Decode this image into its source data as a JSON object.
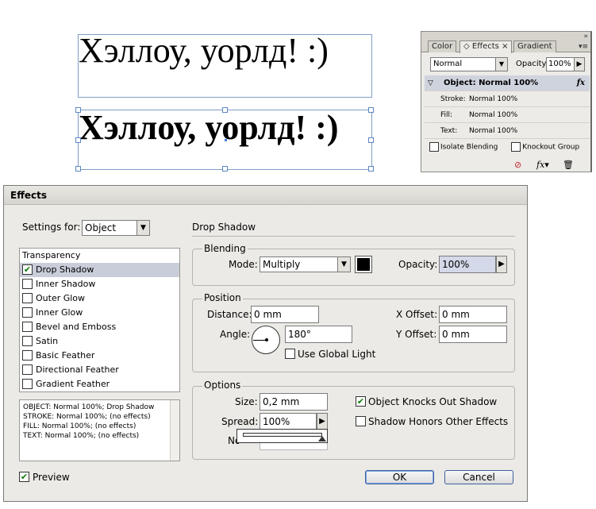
{
  "canvas": {
    "frame1_text": "Хэллоу, уорлд!  :)",
    "frame2_text": "Хэллоу, уорлд!  :)"
  },
  "effects_panel": {
    "tabs": [
      "Color",
      "Effects",
      "Gradient"
    ],
    "tab_close": "×",
    "blend_mode": "Normal",
    "opacity_label": "Opacity:",
    "opacity_value": "100%",
    "rows": [
      {
        "label": "Object:",
        "value": "Normal 100%"
      },
      {
        "label": "Stroke:",
        "value": "Normal 100%"
      },
      {
        "label": "Fill:",
        "value": "Normal 100%"
      },
      {
        "label": "Text:",
        "value": "Normal 100%"
      }
    ],
    "isolate_blending": "Isolate Blending",
    "knockout_group": "Knockout Group",
    "fx_label": "fx"
  },
  "dialog": {
    "title": "Effects",
    "settings_for_label": "Settings for:",
    "settings_for_value": "Object",
    "section_title": "Drop Shadow",
    "effects_header": "Transparency",
    "effects": [
      {
        "label": "Drop Shadow",
        "checked": true
      },
      {
        "label": "Inner Shadow",
        "checked": false
      },
      {
        "label": "Outer Glow",
        "checked": false
      },
      {
        "label": "Inner Glow",
        "checked": false
      },
      {
        "label": "Bevel and Emboss",
        "checked": false
      },
      {
        "label": "Satin",
        "checked": false
      },
      {
        "label": "Basic Feather",
        "checked": false
      },
      {
        "label": "Directional Feather",
        "checked": false
      },
      {
        "label": "Gradient Feather",
        "checked": false
      }
    ],
    "summary_lines": [
      "OBJECT: Normal 100%; Drop Shadow",
      "STROKE: Normal 100%; (no effects)",
      "FILL: Normal 100%; (no effects)",
      "TEXT: Normal 100%; (no effects)"
    ],
    "blending": {
      "title": "Blending",
      "mode_label": "Mode:",
      "mode_value": "Multiply",
      "opacity_label": "Opacity:",
      "opacity_value": "100%",
      "color": "#000000"
    },
    "position": {
      "title": "Position",
      "distance_label": "Distance:",
      "distance_value": "0 mm",
      "angle_label": "Angle:",
      "angle_value": "180°",
      "use_global_light": "Use Global Light",
      "x_offset_label": "X Offset:",
      "x_offset_value": "0 mm",
      "y_offset_label": "Y Offset:",
      "y_offset_value": "0 mm"
    },
    "options": {
      "title": "Options",
      "size_label": "Size:",
      "size_value": "0,2 mm",
      "spread_label": "Spread:",
      "spread_value": "100%",
      "noise_label": "Noise:",
      "object_knocks_out": "Object Knocks Out Shadow",
      "shadow_honors": "Shadow Honors Other Effects"
    },
    "preview_label": "Preview",
    "ok_label": "OK",
    "cancel_label": "Cancel"
  }
}
